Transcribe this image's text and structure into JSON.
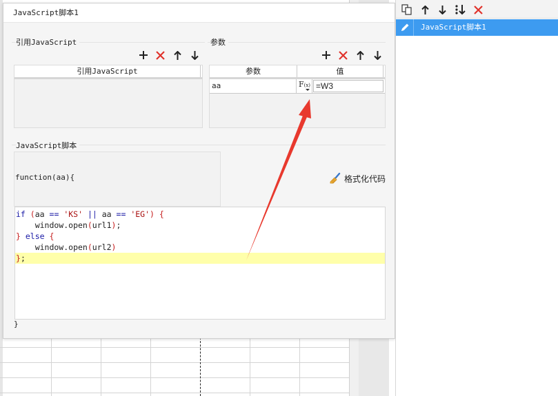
{
  "dialog": {
    "title": "JavaScript脚本1",
    "ref_section": {
      "label": "引用JavaScript",
      "column": "引用JavaScript"
    },
    "param_section": {
      "label": "参数",
      "columns": [
        "参数",
        "值"
      ],
      "rows": [
        {
          "name": "aa",
          "fx_label": "F",
          "fx_sub": "(x)",
          "value": "=W3"
        }
      ]
    },
    "script_section": {
      "label": "JavaScript脚本",
      "function_signature": "function(aa){",
      "format_button": "格式化代码",
      "closing_brace": "}"
    }
  },
  "right_panel": {
    "items": [
      {
        "label": "JavaScript脚本1",
        "selected": true
      }
    ]
  },
  "colors": {
    "selected_item": "#3d9bf0",
    "delete_red": "#e0322b",
    "active_line": "#ffffaa",
    "annotation_arrow": "#e8392e"
  },
  "icons": [
    "add-icon",
    "delete-icon",
    "arrow-up-icon",
    "arrow-down-icon",
    "copy-icon",
    "move-to-bottom-icon",
    "pencil-icon",
    "broom-icon"
  ]
}
